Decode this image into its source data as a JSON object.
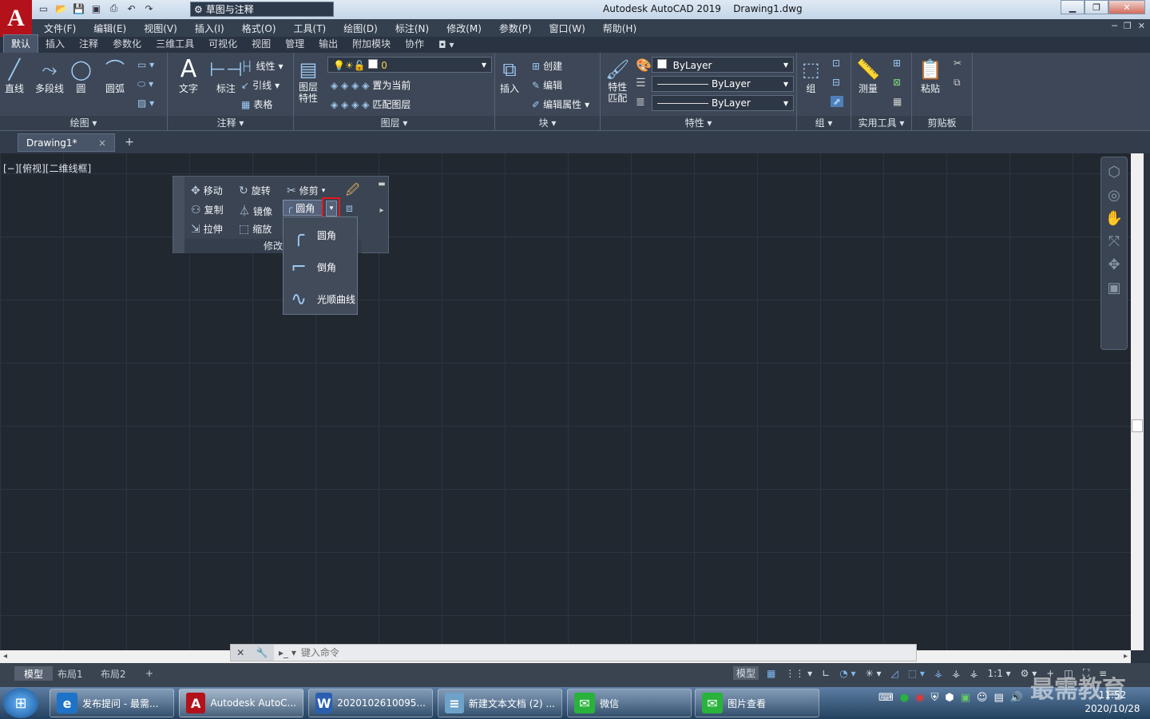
{
  "app": {
    "title": "Autodesk AutoCAD 2019",
    "document": "Drawing1.dwg",
    "logo": "A",
    "workspace": "草图与注释"
  },
  "menu": [
    "文件(F)",
    "编辑(E)",
    "视图(V)",
    "插入(I)",
    "格式(O)",
    "工具(T)",
    "绘图(D)",
    "标注(N)",
    "修改(M)",
    "参数(P)",
    "窗口(W)",
    "帮助(H)"
  ],
  "ribbon_tabs": [
    "默认",
    "插入",
    "注释",
    "参数化",
    "三维工具",
    "可视化",
    "视图",
    "管理",
    "输出",
    "附加模块",
    "协作"
  ],
  "ribbon": {
    "draw": {
      "title": "绘图",
      "line": "直线",
      "polyline": "多段线",
      "circle": "圆",
      "arc": "圆弧"
    },
    "annotation": {
      "title": "注释",
      "text": "文字",
      "dimension": "标注",
      "linear": "线性",
      "leader": "引线",
      "table": "表格"
    },
    "layers": {
      "title": "图层",
      "props": "图层\n特性",
      "current_layer": "0",
      "set_current": "置为当前",
      "match_layer": "匹配图层"
    },
    "block": {
      "title": "块",
      "insert": "插入",
      "create": "创建",
      "edit": "编辑",
      "edit_attr": "编辑属性"
    },
    "properties": {
      "title": "特性",
      "match": "特性\n匹配",
      "color": "ByLayer",
      "linetype": "ByLayer",
      "lineweight": "ByLayer"
    },
    "groups": {
      "title": "组",
      "group": "组"
    },
    "utilities": {
      "title": "实用工具",
      "measure": "测量"
    },
    "clipboard": {
      "title": "剪贴板",
      "paste": "粘贴"
    }
  },
  "file_tab": {
    "name": "Drawing1*",
    "close": "×",
    "plus": "+"
  },
  "viewport_label": "[−][俯视][二维线框]",
  "modify_toolbar": {
    "move": "移动",
    "rotate": "旋转",
    "trim": "修剪",
    "copy": "复制",
    "mirror": "镜像",
    "fillet": "圆角",
    "stretch": "拉伸",
    "scale": "缩放",
    "title": "修改"
  },
  "fillet_menu": [
    "圆角",
    "倒角",
    "光顺曲线"
  ],
  "command": {
    "placeholder": "键入命令"
  },
  "layout_tabs": [
    "模型",
    "布局1",
    "布局2"
  ],
  "status": {
    "model": "模型",
    "scale": "1:1"
  },
  "taskbar": [
    {
      "label": "发布提问 - 最需...",
      "icon": "e",
      "color": "#1e73c8"
    },
    {
      "label": "Autodesk AutoC...",
      "icon": "A",
      "color": "#b4121b"
    },
    {
      "label": "2020102610095...",
      "icon": "W",
      "color": "#2a5fb0"
    },
    {
      "label": "新建文本文档 (2) ...",
      "icon": "≡",
      "color": "#6ea2c9"
    },
    {
      "label": "微信",
      "icon": "✉",
      "color": "#29b23c"
    },
    {
      "label": "图片查看",
      "icon": "✉",
      "color": "#29b23c"
    }
  ],
  "clock": {
    "time": "11:52",
    "date": "2020/10/28"
  },
  "watermark": "最需教育"
}
